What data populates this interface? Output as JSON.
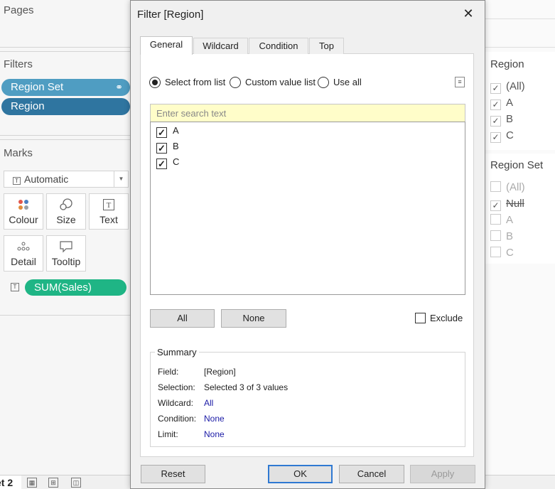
{
  "left_panel": {
    "pages_title": "Pages",
    "filters_title": "Filters",
    "filters": [
      "Region Set",
      "Region"
    ],
    "marks_title": "Marks",
    "mark_type": "Automatic",
    "mark_buttons": [
      "Colour",
      "Size",
      "Text",
      "Detail",
      "Tooltip"
    ],
    "measure_pill": "SUM(Sales)"
  },
  "right_panel": {
    "region_card": {
      "title": "Region",
      "items": [
        {
          "label": "(All)",
          "checked": true
        },
        {
          "label": "A",
          "checked": true
        },
        {
          "label": "B",
          "checked": true
        },
        {
          "label": "C",
          "checked": true
        }
      ]
    },
    "region_set_card": {
      "title": "Region Set",
      "items": [
        {
          "label": "(All)",
          "checked": false
        },
        {
          "label": "Null",
          "checked": true
        },
        {
          "label": "A",
          "checked": false
        },
        {
          "label": "B",
          "checked": false
        },
        {
          "label": "C",
          "checked": false
        }
      ]
    }
  },
  "bottom_bar": {
    "sheet_tab": "et 2"
  },
  "dialog": {
    "title": "Filter [Region]",
    "tabs": [
      "General",
      "Wildcard",
      "Condition",
      "Top"
    ],
    "active_tab": "General",
    "radio_options": [
      "Select from list",
      "Custom value list",
      "Use all"
    ],
    "selected_radio": "Select from list",
    "search_placeholder": "Enter search text",
    "list_items": [
      {
        "label": "A",
        "checked": true
      },
      {
        "label": "B",
        "checked": true
      },
      {
        "label": "C",
        "checked": true
      }
    ],
    "all_button": "All",
    "none_button": "None",
    "exclude_label": "Exclude",
    "summary": {
      "legend": "Summary",
      "rows": [
        {
          "label": "Field:",
          "value": "[Region]",
          "link": false
        },
        {
          "label": "Selection:",
          "value": "Selected 3 of 3 values",
          "link": false
        },
        {
          "label": "Wildcard:",
          "value": "All",
          "link": true
        },
        {
          "label": "Condition:",
          "value": "None",
          "link": true
        },
        {
          "label": "Limit:",
          "value": "None",
          "link": true
        }
      ]
    },
    "footer": {
      "reset": "Reset",
      "ok": "OK",
      "cancel": "Cancel",
      "apply": "Apply"
    }
  },
  "colors": {
    "filter_pill_set": "#4f9dc2",
    "filter_pill_region": "#2f75a0",
    "measure_pill": "#1fb585",
    "search_bg": "#fffdc9",
    "link_blue": "#1a1aa6",
    "ok_border": "#2f79d2"
  }
}
